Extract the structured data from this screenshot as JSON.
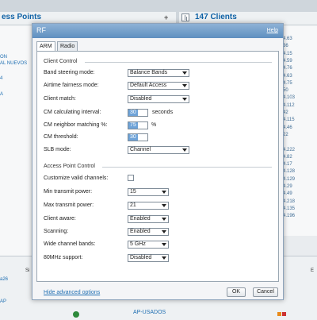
{
  "background": {
    "ap_title": "ess Points",
    "clients_title": "147 Clients",
    "left_items": [
      "ON",
      "AL NUEVOS",
      "4",
      "A"
    ],
    "right_items": [
      "4.63",
      "36",
      "4.15",
      "4.59",
      "4.76",
      "4.63",
      "4.75",
      "50",
      "4.103",
      "4.112",
      "42",
      "4.115",
      "4.46",
      "22",
      "",
      "4.222",
      "4.82",
      "4.17",
      "4.128",
      "4.129",
      "4.29",
      "4.49",
      "4.218",
      "4.135",
      "4.196"
    ],
    "bottom_left_1": "a26",
    "bottom_left_2": "AP",
    "bottom_si": "Si",
    "bottom_ed": "E",
    "bottom_apusados": "AP-USADOS"
  },
  "dialog": {
    "title": "RF",
    "help": "Help",
    "tabs": [
      "ARM",
      "Radio"
    ],
    "client_control": {
      "heading": "Client Control",
      "band_steering_label": "Band steering mode:",
      "band_steering_value": "Balance Bands",
      "airtime_label": "Airtime fairness mode:",
      "airtime_value": "Default Access",
      "client_match_label": "Client match:",
      "client_match_value": "Disabled",
      "cm_interval_label": "CM calculating interval:",
      "cm_interval_value": "30",
      "cm_interval_unit": "seconds",
      "cm_neighbor_label": "CM neighbor matching %:",
      "cm_neighbor_value": "75",
      "cm_neighbor_unit": "%",
      "cm_threshold_label": "CM threshold:",
      "cm_threshold_value": "30",
      "slb_label": "SLB mode:",
      "slb_value": "Channel"
    },
    "ap_control": {
      "heading": "Access Point Control",
      "customize_label": "Customize valid channels:",
      "customize_checked": false,
      "min_power_label": "Min transmit power:",
      "min_power_value": "15",
      "max_power_label": "Max transmit power:",
      "max_power_value": "21",
      "client_aware_label": "Client aware:",
      "client_aware_value": "Enabled",
      "scanning_label": "Scanning:",
      "scanning_value": "Enabled",
      "wide_bands_label": "Wide channel bands:",
      "wide_bands_value": "5 GHz",
      "mhz80_label": "80MHz support:",
      "mhz80_value": "Disabled"
    },
    "hide_advanced": "Hide advanced options",
    "ok": "OK",
    "cancel": "Cancel"
  },
  "colors": {
    "title_bar": "#5e8fc0",
    "link": "#1f6fb2",
    "highlight": "#6ea3d8"
  }
}
